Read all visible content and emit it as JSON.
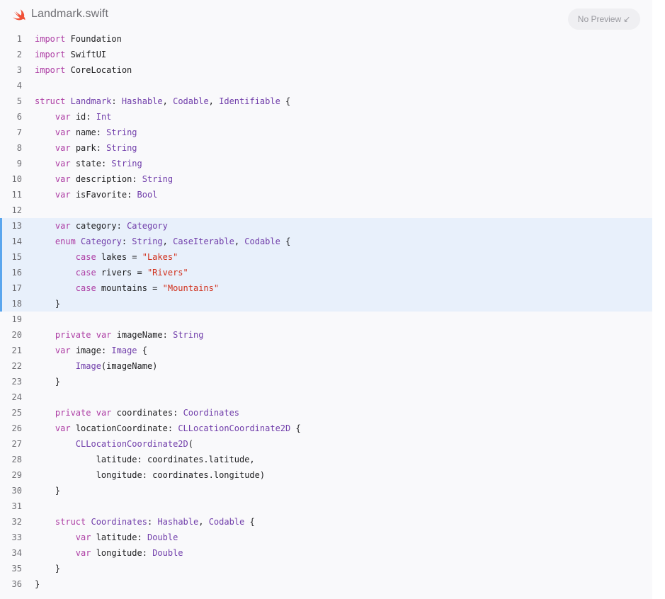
{
  "header": {
    "file_name": "Landmark.swift",
    "file_icon": "swift-logo-icon",
    "preview_label": "No Preview",
    "preview_icon": "arrow-down-left-icon"
  },
  "colors": {
    "keyword": "#ad3da4",
    "type": "#703daa",
    "string": "#d12f1b",
    "text": "#1d1d1f",
    "highlight_bg": "#e8f0fb",
    "highlight_bar": "#5aa6ee",
    "swift_logo": "#f05138"
  },
  "highlighted_lines": [
    13,
    14,
    15,
    16,
    17,
    18
  ],
  "code_lines": [
    [
      [
        "import",
        "kw"
      ],
      [
        " Foundation",
        ""
      ]
    ],
    [
      [
        "import",
        "kw"
      ],
      [
        " SwiftUI",
        ""
      ]
    ],
    [
      [
        "import",
        "kw"
      ],
      [
        " CoreLocation",
        ""
      ]
    ],
    [],
    [
      [
        "struct",
        "kw"
      ],
      [
        " ",
        ""
      ],
      [
        "Landmark",
        "ty"
      ],
      [
        ": ",
        ""
      ],
      [
        "Hashable",
        "ty"
      ],
      [
        ", ",
        ""
      ],
      [
        "Codable",
        "ty"
      ],
      [
        ", ",
        ""
      ],
      [
        "Identifiable",
        "ty"
      ],
      [
        " {",
        ""
      ]
    ],
    [
      [
        "    ",
        ""
      ],
      [
        "var",
        "kw"
      ],
      [
        " id: ",
        ""
      ],
      [
        "Int",
        "ty"
      ]
    ],
    [
      [
        "    ",
        ""
      ],
      [
        "var",
        "kw"
      ],
      [
        " name: ",
        ""
      ],
      [
        "String",
        "ty"
      ]
    ],
    [
      [
        "    ",
        ""
      ],
      [
        "var",
        "kw"
      ],
      [
        " park: ",
        ""
      ],
      [
        "String",
        "ty"
      ]
    ],
    [
      [
        "    ",
        ""
      ],
      [
        "var",
        "kw"
      ],
      [
        " state: ",
        ""
      ],
      [
        "String",
        "ty"
      ]
    ],
    [
      [
        "    ",
        ""
      ],
      [
        "var",
        "kw"
      ],
      [
        " description: ",
        ""
      ],
      [
        "String",
        "ty"
      ]
    ],
    [
      [
        "    ",
        ""
      ],
      [
        "var",
        "kw"
      ],
      [
        " isFavorite: ",
        ""
      ],
      [
        "Bool",
        "ty"
      ]
    ],
    [],
    [
      [
        "    ",
        ""
      ],
      [
        "var",
        "kw"
      ],
      [
        " category: ",
        ""
      ],
      [
        "Category",
        "ty"
      ]
    ],
    [
      [
        "    ",
        ""
      ],
      [
        "enum",
        "kw"
      ],
      [
        " ",
        ""
      ],
      [
        "Category",
        "ty"
      ],
      [
        ": ",
        ""
      ],
      [
        "String",
        "ty"
      ],
      [
        ", ",
        ""
      ],
      [
        "CaseIterable",
        "ty"
      ],
      [
        ", ",
        ""
      ],
      [
        "Codable",
        "ty"
      ],
      [
        " {",
        ""
      ]
    ],
    [
      [
        "        ",
        ""
      ],
      [
        "case",
        "kw"
      ],
      [
        " lakes = ",
        ""
      ],
      [
        "\"Lakes\"",
        "str"
      ]
    ],
    [
      [
        "        ",
        ""
      ],
      [
        "case",
        "kw"
      ],
      [
        " rivers = ",
        ""
      ],
      [
        "\"Rivers\"",
        "str"
      ]
    ],
    [
      [
        "        ",
        ""
      ],
      [
        "case",
        "kw"
      ],
      [
        " mountains = ",
        ""
      ],
      [
        "\"Mountains\"",
        "str"
      ]
    ],
    [
      [
        "    }",
        ""
      ]
    ],
    [],
    [
      [
        "    ",
        ""
      ],
      [
        "private",
        "kw"
      ],
      [
        " ",
        ""
      ],
      [
        "var",
        "kw"
      ],
      [
        " imageName: ",
        ""
      ],
      [
        "String",
        "ty"
      ]
    ],
    [
      [
        "    ",
        ""
      ],
      [
        "var",
        "kw"
      ],
      [
        " image: ",
        ""
      ],
      [
        "Image",
        "ty"
      ],
      [
        " {",
        ""
      ]
    ],
    [
      [
        "        ",
        ""
      ],
      [
        "Image",
        "ty"
      ],
      [
        "(imageName)",
        ""
      ]
    ],
    [
      [
        "    }",
        ""
      ]
    ],
    [],
    [
      [
        "    ",
        ""
      ],
      [
        "private",
        "kw"
      ],
      [
        " ",
        ""
      ],
      [
        "var",
        "kw"
      ],
      [
        " coordinates: ",
        ""
      ],
      [
        "Coordinates",
        "ty"
      ]
    ],
    [
      [
        "    ",
        ""
      ],
      [
        "var",
        "kw"
      ],
      [
        " locationCoordinate: ",
        ""
      ],
      [
        "CLLocationCoordinate2D",
        "ty"
      ],
      [
        " {",
        ""
      ]
    ],
    [
      [
        "        ",
        ""
      ],
      [
        "CLLocationCoordinate2D",
        "ty"
      ],
      [
        "(",
        ""
      ]
    ],
    [
      [
        "            latitude: coordinates.latitude,",
        ""
      ]
    ],
    [
      [
        "            longitude: coordinates.longitude)",
        ""
      ]
    ],
    [
      [
        "    }",
        ""
      ]
    ],
    [],
    [
      [
        "    ",
        ""
      ],
      [
        "struct",
        "kw"
      ],
      [
        " ",
        ""
      ],
      [
        "Coordinates",
        "ty"
      ],
      [
        ": ",
        ""
      ],
      [
        "Hashable",
        "ty"
      ],
      [
        ", ",
        ""
      ],
      [
        "Codable",
        "ty"
      ],
      [
        " {",
        ""
      ]
    ],
    [
      [
        "        ",
        ""
      ],
      [
        "var",
        "kw"
      ],
      [
        " latitude: ",
        ""
      ],
      [
        "Double",
        "ty"
      ]
    ],
    [
      [
        "        ",
        ""
      ],
      [
        "var",
        "kw"
      ],
      [
        " longitude: ",
        ""
      ],
      [
        "Double",
        "ty"
      ]
    ],
    [
      [
        "    }",
        ""
      ]
    ],
    [
      [
        "}",
        ""
      ]
    ]
  ]
}
